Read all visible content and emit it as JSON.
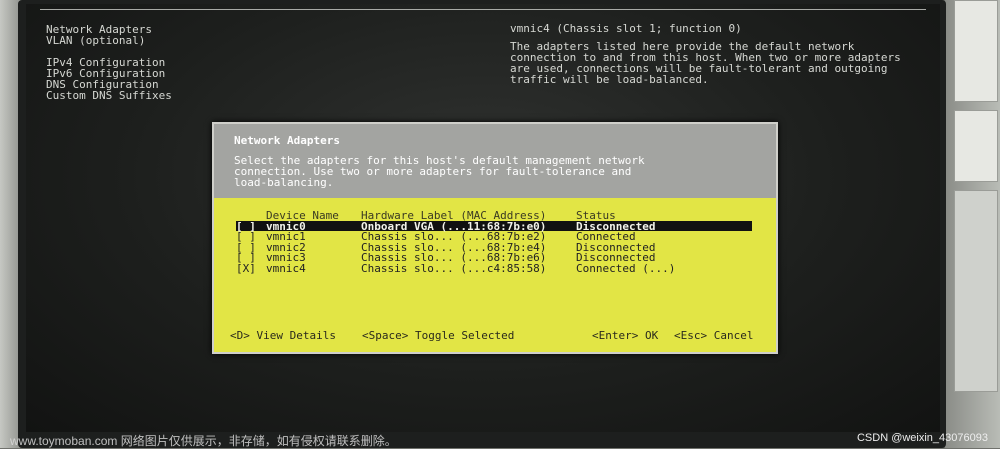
{
  "left_menu": {
    "items": [
      "Network Adapters",
      "VLAN (optional)",
      "",
      "IPv4 Configuration",
      "IPv6 Configuration",
      "DNS Configuration",
      "Custom DNS Suffixes"
    ]
  },
  "detail": {
    "title": "vmnic4 (Chassis slot 1; function 0)",
    "lines": [
      "The adapters listed here provide the default network",
      "connection to and from this host. When two or more adapters",
      "are used, connections will be fault-tolerant and outgoing",
      "traffic will be load-balanced."
    ]
  },
  "dialog": {
    "title": "Network Adapters",
    "description": [
      "Select the adapters for this host's default management network",
      "connection. Use two or more adapters for fault-tolerance and",
      "load-balancing."
    ],
    "columns": [
      "Device Name",
      "Hardware Label (MAC Address)",
      "Status"
    ],
    "rows": [
      {
        "check": "[ ]",
        "device": "vmnic0",
        "label": "Onboard VGA (...11:68:7b:e0)",
        "status": "Disconnected"
      },
      {
        "check": "[ ]",
        "device": "vmnic1",
        "label": "Chassis slo... (...68:7b:e2)",
        "status": "Connected"
      },
      {
        "check": "[ ]",
        "device": "vmnic2",
        "label": "Chassis slo... (...68:7b:e4)",
        "status": "Disconnected"
      },
      {
        "check": "[ ]",
        "device": "vmnic3",
        "label": "Chassis slo... (...68:7b:e6)",
        "status": "Disconnected"
      },
      {
        "check": "[X]",
        "device": "vmnic4",
        "label": "Chassis slo... (...c4:85:58)",
        "status": "Connected (...)"
      }
    ],
    "footer": {
      "view_details": "<D> View Details",
      "toggle": "<Space> Toggle Selected",
      "ok": "<Enter> OK",
      "cancel": "<Esc> Cancel"
    }
  },
  "watermarks": {
    "left": "www.toymoban.com 网络图片仅供展示，非存储，如有侵权请联系删除。",
    "right": "CSDN @weixin_43076093"
  }
}
